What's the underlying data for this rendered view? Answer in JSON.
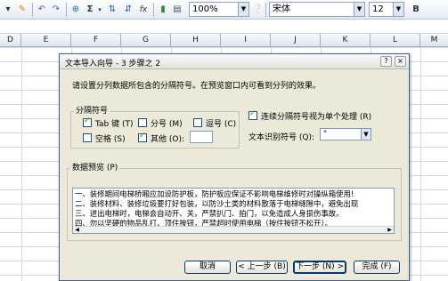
{
  "toolbar": {
    "zoom": "100%",
    "font_name": "宋体",
    "font_size": "12",
    "bold": "B",
    "sigma": "Σ",
    "fx": "fx"
  },
  "columns": [
    "D",
    "E",
    "F",
    "G",
    "H",
    "I",
    "J",
    "K",
    "L",
    "M"
  ],
  "dialog": {
    "title": "文本导入向导 - 3 步骤之 2",
    "help": "?",
    "close": "×",
    "instruction": "请设置分列数据所包含的分隔符号。在预览窗口内可看到分列的效果。",
    "delimiters_title": "分隔符号",
    "tab_label": "Tab 键 (T)",
    "semicolon_label": "分号 (M)",
    "comma_label": "逗号 (C)",
    "space_label": "空格 (S)",
    "other_label": "其他 (O):",
    "other_value": "",
    "consecutive_label": "连续分隔符号视为单个处理 (R)",
    "qualifier_label": "文本识别符号 (Q):",
    "qualifier_value": "\"",
    "preview_title": "数据预览 (P)",
    "preview_lines": [
      "一、装修期间电梯桥厢应加设防护板，防护板应保证不影响电梯维修时对操纵箱使用!",
      "二、装修材料、装修垃圾要打好包装，以防沙土类的材料散落于电梯缝隙中，避免出现",
      "三、进出电梯时，电梯会自动开、关，严禁扒门、拍门，以免造成人身损伤事故。",
      "四、勿以坚硬的物品乱打、顶住按钮，严禁超时使用电梯（按住按钮不松开）。"
    ],
    "buttons": {
      "cancel": "取消",
      "back": "< 上一步 (B)",
      "next": "下一步 (N) >",
      "finish": "完成 (F)"
    }
  }
}
